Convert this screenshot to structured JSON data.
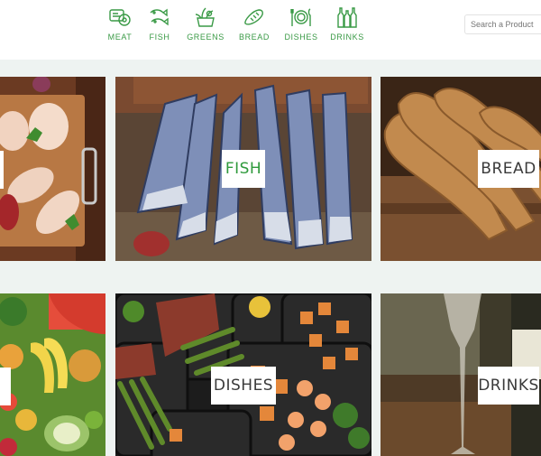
{
  "nav": {
    "items": [
      {
        "label": "MEAT",
        "icon": "meat-icon"
      },
      {
        "label": "FISH",
        "icon": "fish-icon"
      },
      {
        "label": "GREENS",
        "icon": "greens-icon"
      },
      {
        "label": "BREAD",
        "icon": "bread-icon"
      },
      {
        "label": "DISHES",
        "icon": "dishes-icon"
      },
      {
        "label": "DRINKS",
        "icon": "drinks-icon"
      }
    ]
  },
  "search": {
    "placeholder": "Search a Product"
  },
  "tiles": {
    "fish": {
      "label": "FISH"
    },
    "bread": {
      "label": "BREAD"
    },
    "dishes": {
      "label": "DISHES"
    },
    "drinks": {
      "label": "DRINKS"
    }
  },
  "colors": {
    "accent": "#3a9a46",
    "fish_label": "#2f9a3c"
  }
}
